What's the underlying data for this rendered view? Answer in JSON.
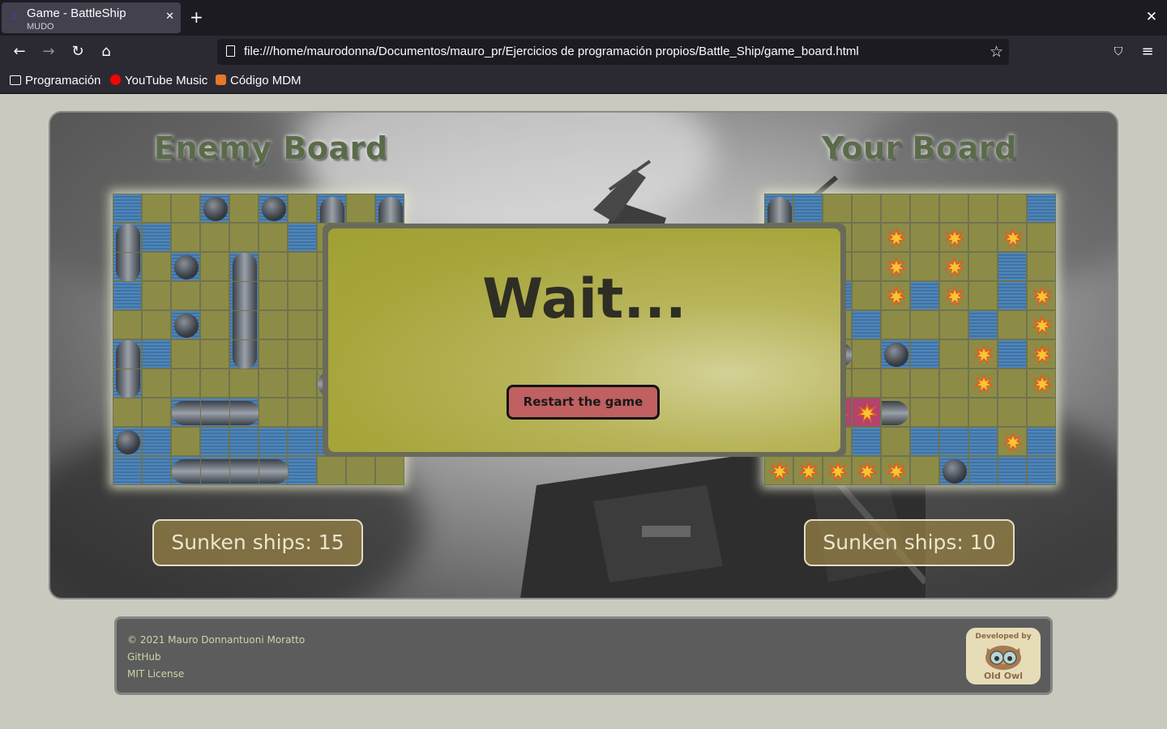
{
  "browser": {
    "tab_title": "Game - BattleShip",
    "tab_subtitle": "MUDO",
    "url": "file:///home/maurodonna/Documentos/mauro_pr/Ejercicios de programación propios/Battle_Ship/game_board.html",
    "bookmarks": [
      "Programación",
      "YouTube Music",
      "Código MDM"
    ]
  },
  "game": {
    "enemy_title": "Enemy Board",
    "your_title": "Your Board",
    "enemy_sunk": "Sunken ships: 15",
    "your_sunk": "Sunken ships: 10",
    "modal_text": "Wait...",
    "restart_label": "Restart the game",
    "enemy_grid": [
      "WLLBLBLPLP",
      "SWLLLLWLLL",
      "SLBLSLLLLL",
      "WLLLSLLLLL",
      "LLBLSLLLLL",
      "SWLLSLLLLL",
      "SLLLLLLRLL",
      "LLHHHLLLLL",
      "BWLWWWWWLL",
      "WWHHHHWLLL"
    ],
    "your_grid": [
      "PWLLLLLLLW",
      "LLLLXLXLXL",
      "LLLLXLXLWL",
      "LWWLXWXLWX",
      "LWLWLLLWLX",
      "LRRLBWLXWX",
      "LLLLLLLXLX",
      "LLXXRLLLLL",
      "LLLWLWWWXW",
      "XXXXXLBWWW"
    ]
  },
  "footer": {
    "copyright": "© 2021 Mauro Donnantuoni Moratto",
    "github": "GitHub",
    "license": "MIT License",
    "badge_top": "Developed by",
    "badge_bottom": "Old Owl"
  }
}
